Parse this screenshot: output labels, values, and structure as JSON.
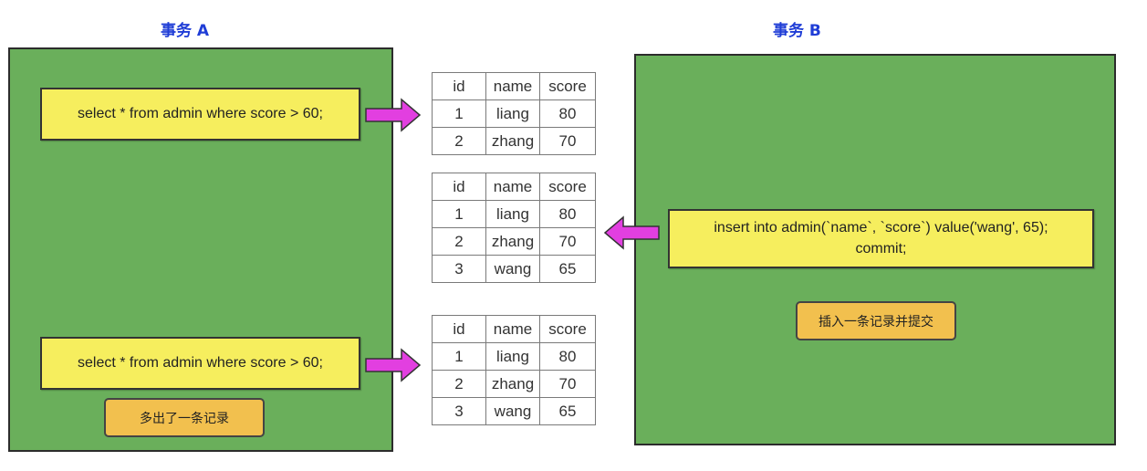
{
  "transaction_a": {
    "title": "事务 A",
    "query_1": "select * from admin where score > 60;",
    "query_2": "select * from admin where score > 60;",
    "note": "多出了一条记录"
  },
  "transaction_b": {
    "title": "事务 B",
    "query": "insert into admin(`name`, `score`) value('wang', 65);\ncommit;",
    "note": "插入一条记录并提交"
  },
  "tables": {
    "headers": [
      "id",
      "name",
      "score"
    ],
    "table_1": [
      [
        "1",
        "liang",
        "80"
      ],
      [
        "2",
        "zhang",
        "70"
      ]
    ],
    "table_2": [
      [
        "1",
        "liang",
        "80"
      ],
      [
        "2",
        "zhang",
        "70"
      ],
      [
        "3",
        "wang",
        "65"
      ]
    ],
    "table_3": [
      [
        "1",
        "liang",
        "80"
      ],
      [
        "2",
        "zhang",
        "70"
      ],
      [
        "3",
        "wang",
        "65"
      ]
    ]
  },
  "colors": {
    "panel": "#6aaf5b",
    "sql_box": "#f6ee5e",
    "note_box": "#f2c04e",
    "arrow": "#e23fe0",
    "title": "#1f3dd6"
  }
}
